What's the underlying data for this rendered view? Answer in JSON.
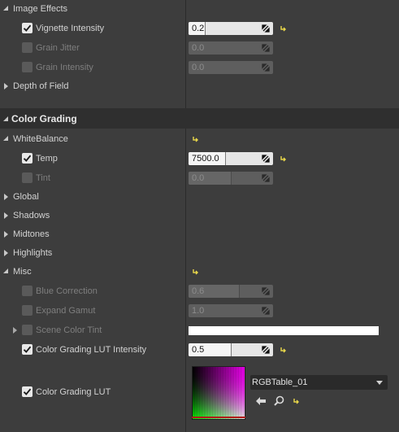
{
  "image_effects": {
    "header": "Image Effects",
    "vignette": {
      "label": "Vignette Intensity",
      "value": "0.2",
      "fill": 0.2
    },
    "grain_jitter": {
      "label": "Grain Jitter",
      "value": "0.0",
      "fill": 0.0
    },
    "grain_intensity": {
      "label": "Grain Intensity",
      "value": "0.0",
      "fill": 0.0
    }
  },
  "depth_of_field": {
    "label": "Depth of Field"
  },
  "color_grading": {
    "title": "Color Grading",
    "white_balance": {
      "header": "WhiteBalance",
      "temp": {
        "label": "Temp",
        "value": "7500.0",
        "fill": 0.43
      },
      "tint": {
        "label": "Tint",
        "value": "0.0",
        "fill": 0.5
      }
    },
    "groups": [
      "Global",
      "Shadows",
      "Midtones",
      "Highlights"
    ],
    "misc": {
      "header": "Misc",
      "blue_correction": {
        "label": "Blue Correction",
        "value": "0.6",
        "fill": 0.6
      },
      "expand_gamut": {
        "label": "Expand Gamut",
        "value": "1.0",
        "fill": 1.0
      },
      "scene_color_tint": {
        "label": "Scene Color Tint",
        "color": "#ffffff"
      },
      "lut_intensity": {
        "label": "Color Grading LUT Intensity",
        "value": "0.5",
        "fill": 0.5
      },
      "lut": {
        "label": "Color Grading LUT",
        "asset": "RGBTable_01"
      }
    }
  },
  "colors": {
    "accent_reset": "#e8d64a",
    "panel_bg": "#3d3d3d",
    "header_bg": "#2f2f2f"
  }
}
